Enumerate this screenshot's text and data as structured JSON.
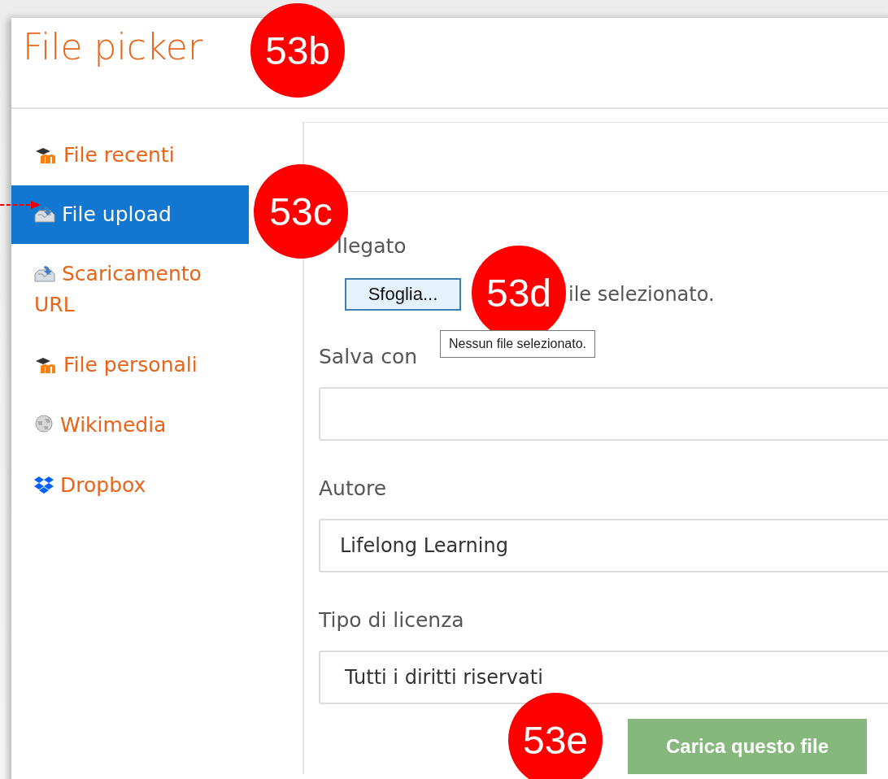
{
  "window": {
    "title": "File picker"
  },
  "sidebar": {
    "items": [
      {
        "label": "File recenti",
        "kind": "moodle",
        "selected": false
      },
      {
        "label": "File upload",
        "kind": "upload",
        "selected": true
      },
      {
        "label": "Scaricamento URL",
        "kind": "upload",
        "selected": false
      },
      {
        "label": "File personali",
        "kind": "moodle",
        "selected": false
      },
      {
        "label": "Wikimedia",
        "kind": "globe",
        "selected": false
      },
      {
        "label": "Dropbox",
        "kind": "dropbox",
        "selected": false
      }
    ]
  },
  "form": {
    "attachment_label": "llegato",
    "browse_button": "Sfoglia...",
    "file_status": "ile selezionato.",
    "tooltip": "Nessun file selezionato.",
    "save_as_label": "Salva con",
    "author_label": "Autore",
    "author_value": "Lifelong Learning",
    "license_label": "Tipo di licenza",
    "license_value": "Tutti i diritti riservati",
    "submit_button": "Carica questo file"
  },
  "callouts": [
    "53b",
    "53c",
    "53d",
    "53e"
  ]
}
